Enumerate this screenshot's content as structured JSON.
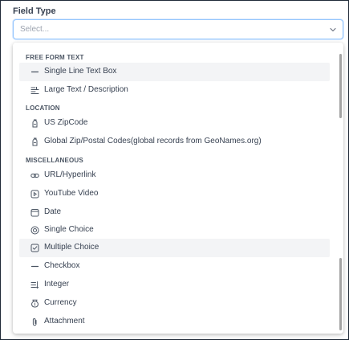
{
  "field": {
    "label": "Field Type",
    "placeholder": "Select..."
  },
  "dropdown": {
    "groups": [
      {
        "header": "FREE FORM TEXT",
        "options": [
          {
            "label": "Single Line Text Box",
            "icon": "line-icon",
            "highlighted": true
          },
          {
            "label": "Large Text / Description",
            "icon": "text-lines-icon",
            "highlighted": false
          }
        ]
      },
      {
        "header": "LOCATION",
        "options": [
          {
            "label": "US ZipCode",
            "icon": "mailbox-icon",
            "highlighted": false
          },
          {
            "label": "Global Zip/Postal Codes(global records from GeoNames.org)",
            "icon": "mailbox-icon",
            "highlighted": false
          }
        ]
      },
      {
        "header": "MISCELLANEOUS",
        "options": [
          {
            "label": "URL/Hyperlink",
            "icon": "link-icon",
            "highlighted": false
          },
          {
            "label": "YouTube Video",
            "icon": "video-icon",
            "highlighted": false
          },
          {
            "label": "Date",
            "icon": "calendar-icon",
            "highlighted": false
          },
          {
            "label": "Single Choice",
            "icon": "radio-icon",
            "highlighted": false
          },
          {
            "label": "Multiple Choice",
            "icon": "checkbox-checked-icon",
            "highlighted": true
          },
          {
            "label": "Checkbox",
            "icon": "line-icon",
            "highlighted": false
          },
          {
            "label": "Integer",
            "icon": "number-list-icon",
            "highlighted": false
          },
          {
            "label": "Currency",
            "icon": "money-bag-icon",
            "highlighted": false
          },
          {
            "label": "Attachment",
            "icon": "paperclip-icon",
            "highlighted": false
          }
        ]
      }
    ]
  },
  "colors": {
    "focus_border": "#93c5fd",
    "highlight_bg": "#f3f4f6",
    "text": "#374151"
  }
}
